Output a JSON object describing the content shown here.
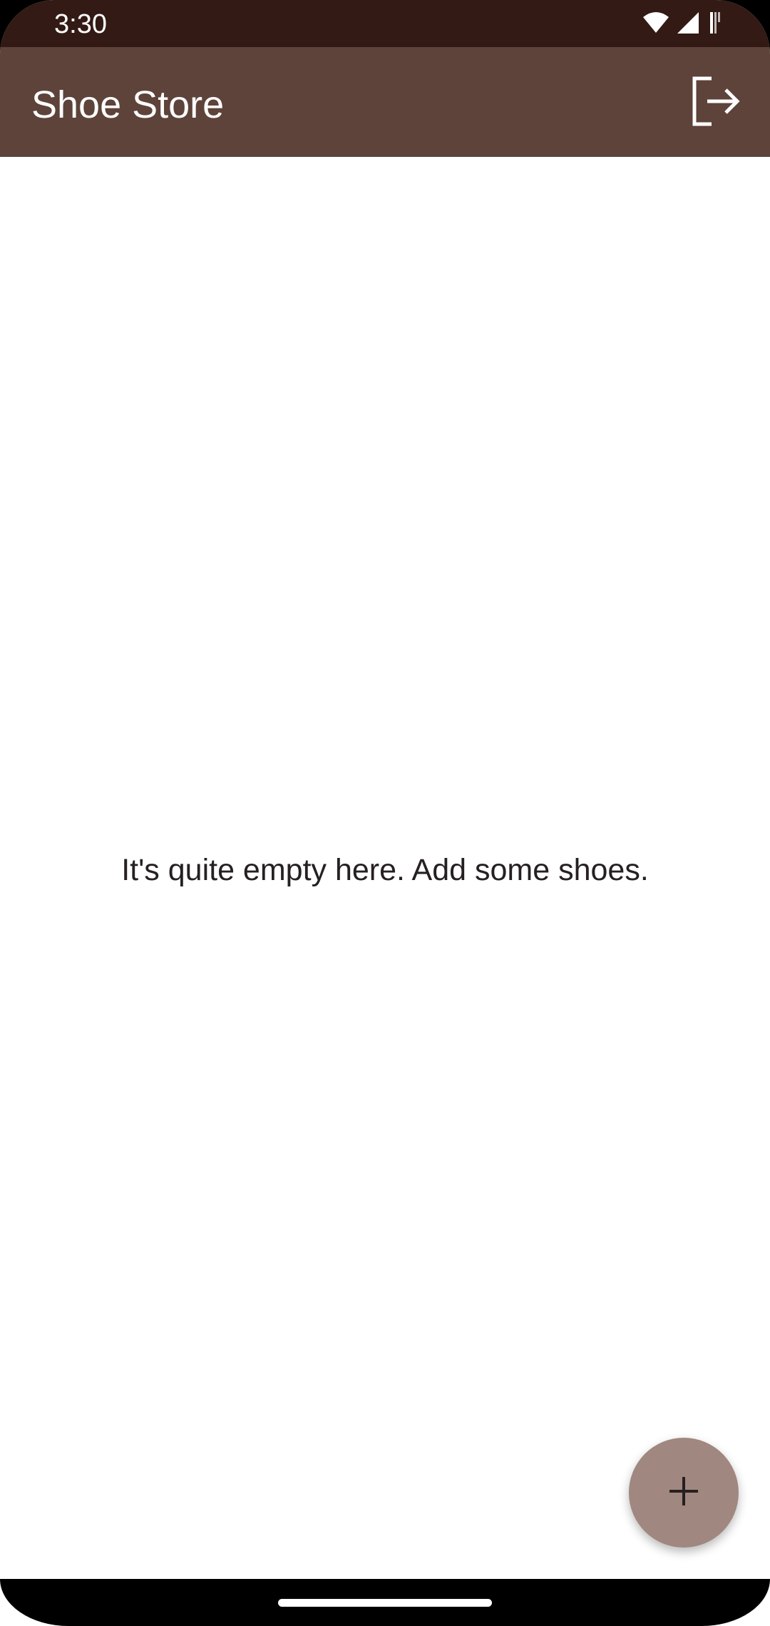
{
  "status_bar": {
    "time": "3:30",
    "icons": [
      "wifi-icon",
      "signal-icon",
      "battery-icon"
    ]
  },
  "app_bar": {
    "title": "Shoe Store",
    "action_icon": "logout-icon"
  },
  "content": {
    "empty_message": "It's quite empty here. Add some shoes."
  },
  "fab": {
    "icon": "add-icon"
  },
  "colors": {
    "status_bar": "#331A14",
    "app_bar": "#5E433A",
    "fab": "#A0877F",
    "text": "#262020"
  }
}
